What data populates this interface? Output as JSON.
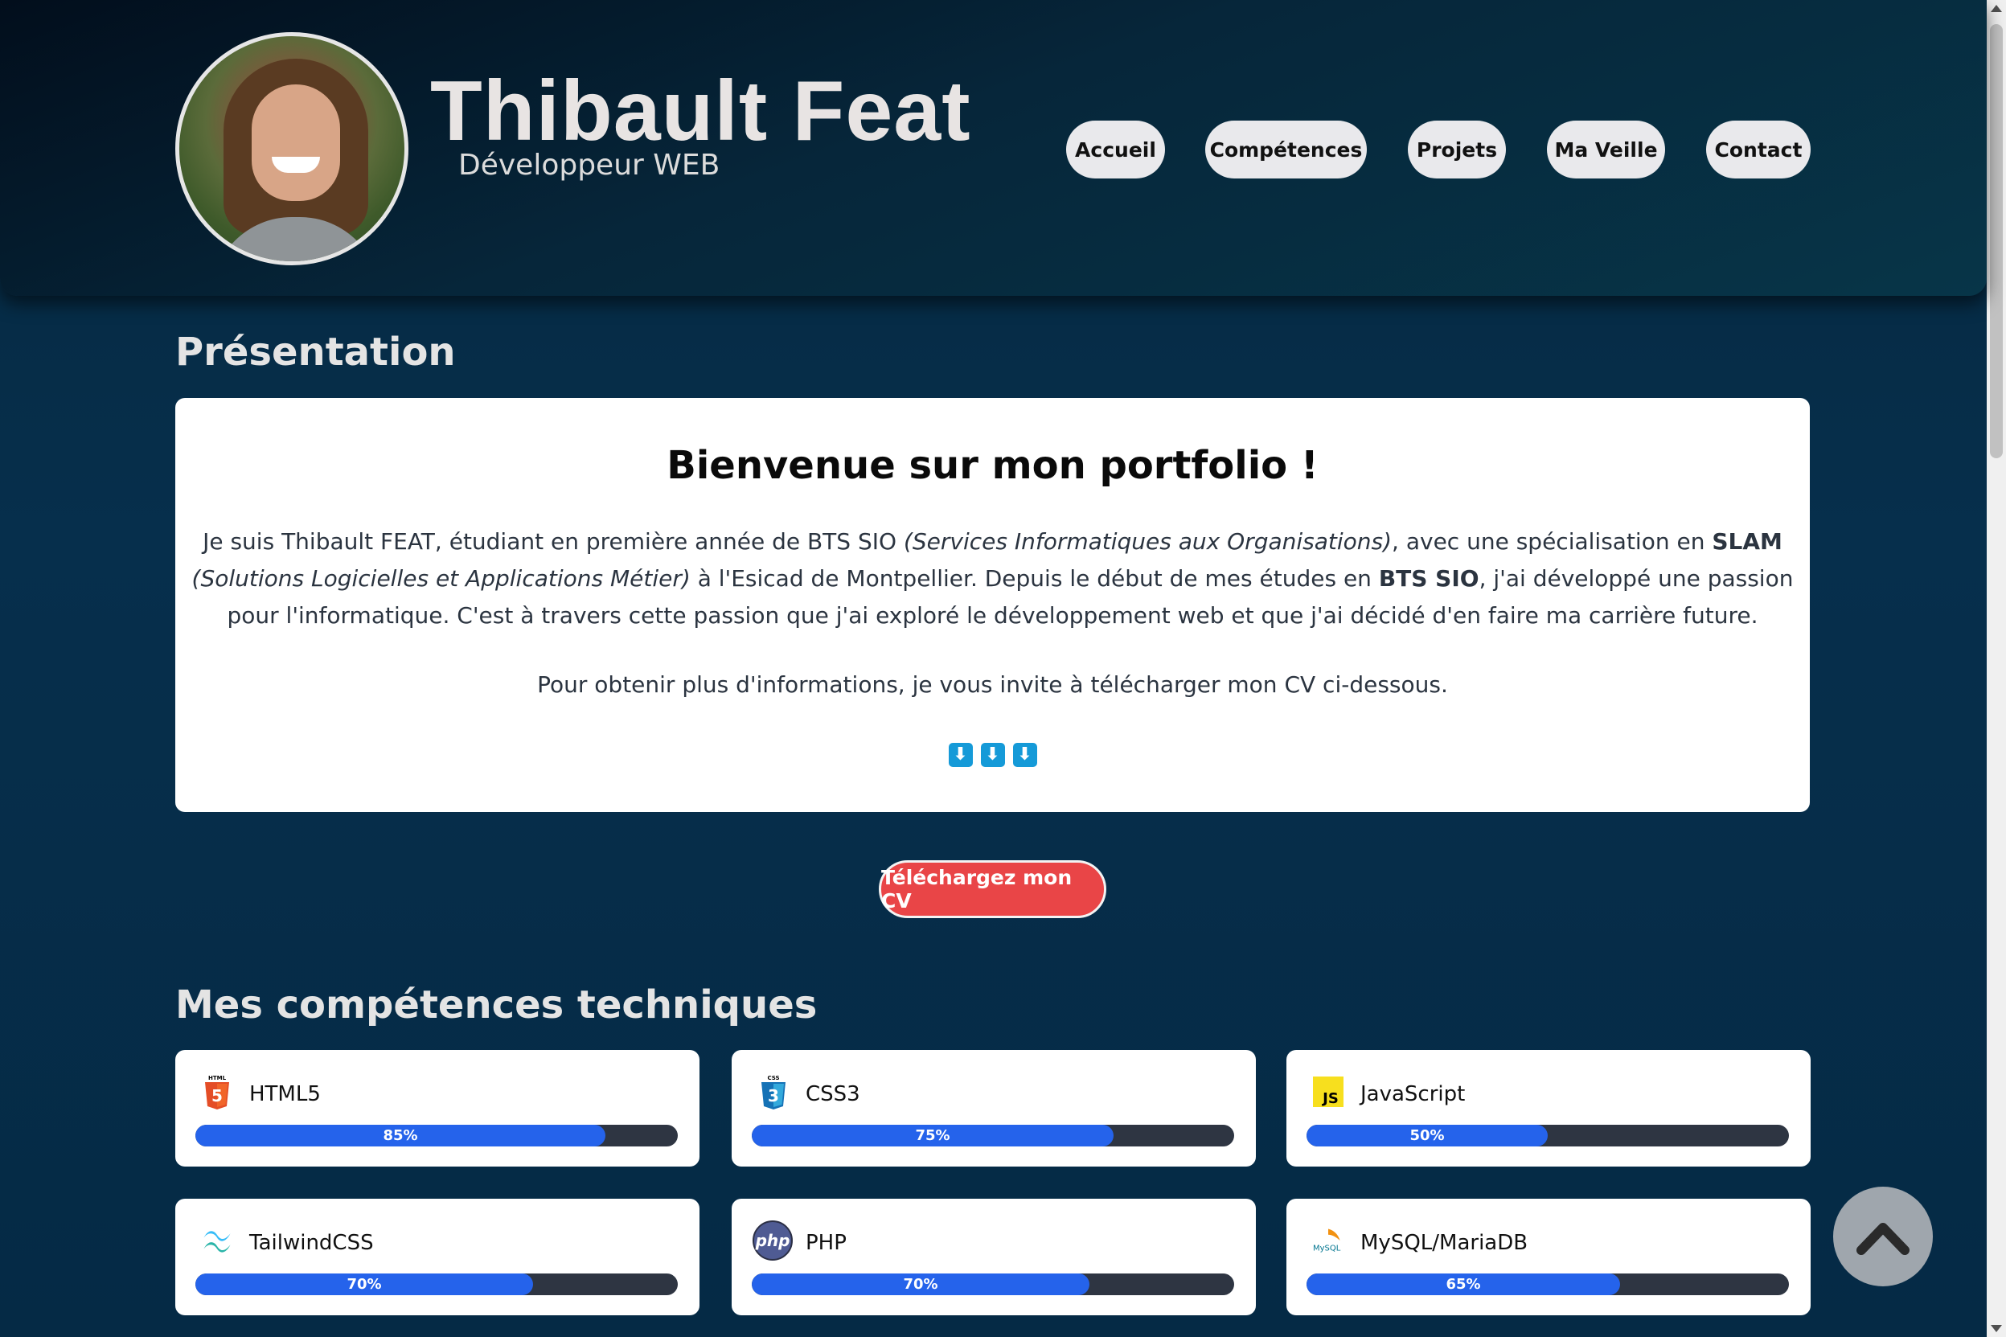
{
  "header": {
    "name": "Thibault Feat",
    "subtitle": "Développeur WEB",
    "nav": [
      "Accueil",
      "Compétences",
      "Projets",
      "Ma Veille",
      "Contact"
    ]
  },
  "presentation": {
    "section_title": "Présentation",
    "heading": "Bienvenue sur mon portfolio !",
    "p1_a": "Je suis Thibault FEAT, étudiant en première année de BTS SIO ",
    "p1_b": "(Services Informatiques aux Organisations)",
    "p1_c": ", avec une spécialisation en ",
    "p1_d": "SLAM",
    "p1_e": " (Solutions Logicielles et Applications Métier)",
    "p1_f": " à l'Esicad de Montpellier. Depuis le début de mes études en ",
    "p1_g": "BTS SIO",
    "p1_h": ", j'ai développé une passion pour l'informatique. C'est à travers cette passion que j'ai exploré le développement web et que j'ai décidé d'en faire ma carrière future.",
    "p2": "Pour obtenir plus d'informations, je vous invite à télécharger mon CV ci-dessous.",
    "arrows": [
      "⬇",
      "⬇",
      "⬇"
    ],
    "cv_button": "Téléchargez mon CV"
  },
  "skills": {
    "section_title": "Mes compétences techniques",
    "items": [
      {
        "name": "HTML5",
        "percent": 85,
        "label": "85%",
        "icon": "html5-icon",
        "color": "#e44d26"
      },
      {
        "name": "CSS3",
        "percent": 75,
        "label": "75%",
        "icon": "css3-icon",
        "color": "#1572b6"
      },
      {
        "name": "JavaScript",
        "percent": 50,
        "label": "50%",
        "icon": "javascript-icon",
        "color": "#f7df1e"
      },
      {
        "name": "TailwindCSS",
        "percent": 70,
        "label": "70%",
        "icon": "tailwindcss-icon",
        "color": "#38bdf8"
      },
      {
        "name": "PHP",
        "percent": 70,
        "label": "70%",
        "icon": "php-icon",
        "color": "#777bb3"
      },
      {
        "name": "MySQL/MariaDB",
        "percent": 65,
        "label": "65%",
        "icon": "mysql-icon",
        "color": "#00758f"
      }
    ]
  },
  "icons": {
    "html5_badge": "HTML",
    "css_badge": "CSS",
    "js_badge": "JS",
    "php_badge": "php",
    "mysql_badge": "MySQL"
  },
  "colors": {
    "background": "#062f4c",
    "accent_bar": "#2563eb",
    "cv_button": "#e94547"
  }
}
